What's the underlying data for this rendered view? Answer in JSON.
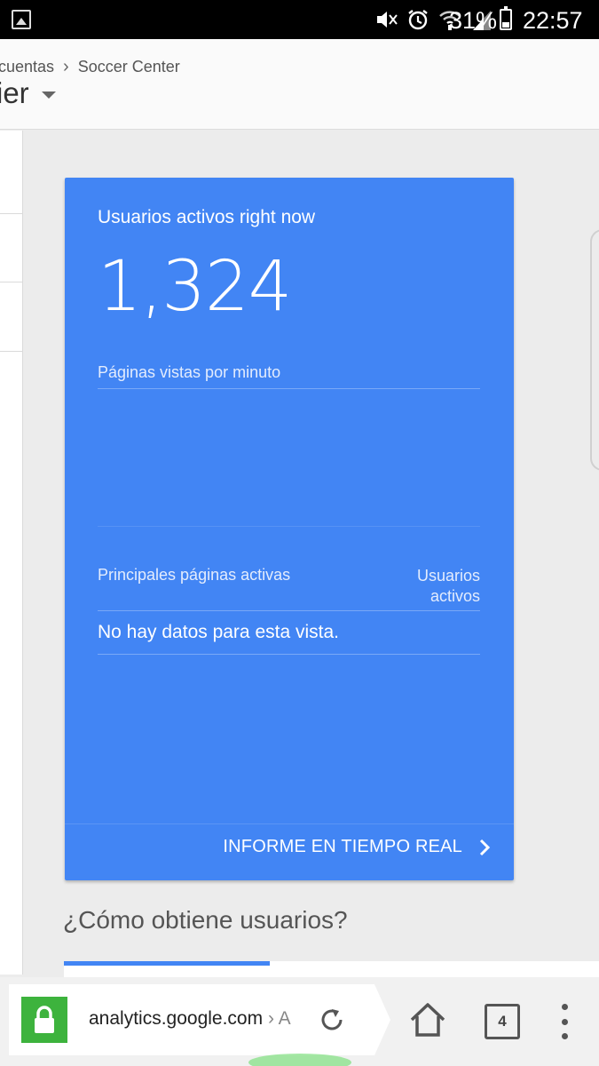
{
  "status_bar": {
    "battery_percent": "31%",
    "time": "22:57",
    "icons": [
      "image-notification-icon",
      "mute-icon",
      "alarm-icon",
      "wifi-icon",
      "signal-icon",
      "battery-icon"
    ]
  },
  "header": {
    "breadcrumb": [
      "cuentas",
      "Soccer Center"
    ],
    "property_title": "ier"
  },
  "card": {
    "title": "Usuarios activos right now",
    "active_users": "1,324",
    "pageviews_label": "Páginas vistas por minuto",
    "top_pages_label": "Principales páginas activas",
    "active_users_col": "Usuarios activos",
    "no_data": "No hay datos para esta vista.",
    "realtime_link": "INFORME EN TIEMPO REAL"
  },
  "section": {
    "title": "¿Cómo obtiene usuarios?"
  },
  "browser": {
    "url_host": "analytics.google.com",
    "url_rest": " › A",
    "tab_count": "4",
    "lock_color": "#3db33d"
  },
  "colors": {
    "card_blue": "#4285f4",
    "status_bar": "#000000"
  }
}
